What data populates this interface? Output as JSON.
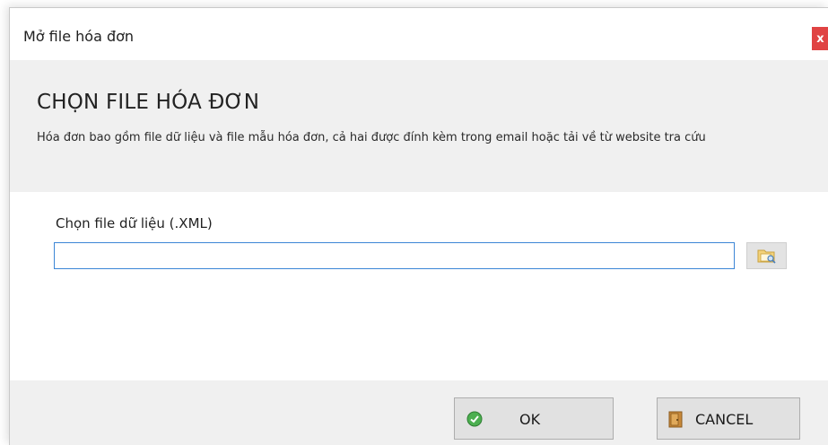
{
  "window": {
    "title": "Mở file hóa đơn",
    "close_label": "x"
  },
  "header": {
    "title": "CHỌN FILE HÓA ĐƠN",
    "description": "Hóa đơn bao gồm file dữ liệu và file mẫu hóa đơn, cả hai được đính kèm trong email hoặc tải về từ website tra cứu"
  },
  "form": {
    "data_file_label": "Chọn file dữ liệu (.XML)",
    "data_file_value": "",
    "browse_icon": "folder-browse-icon"
  },
  "footer": {
    "ok_label": "OK",
    "ok_icon": "check-circle-icon",
    "cancel_label": "CANCEL",
    "cancel_icon": "door-exit-icon"
  },
  "colors": {
    "close_button": "#e04343",
    "input_border": "#3c86d6",
    "ok_icon": "#4caf50"
  }
}
